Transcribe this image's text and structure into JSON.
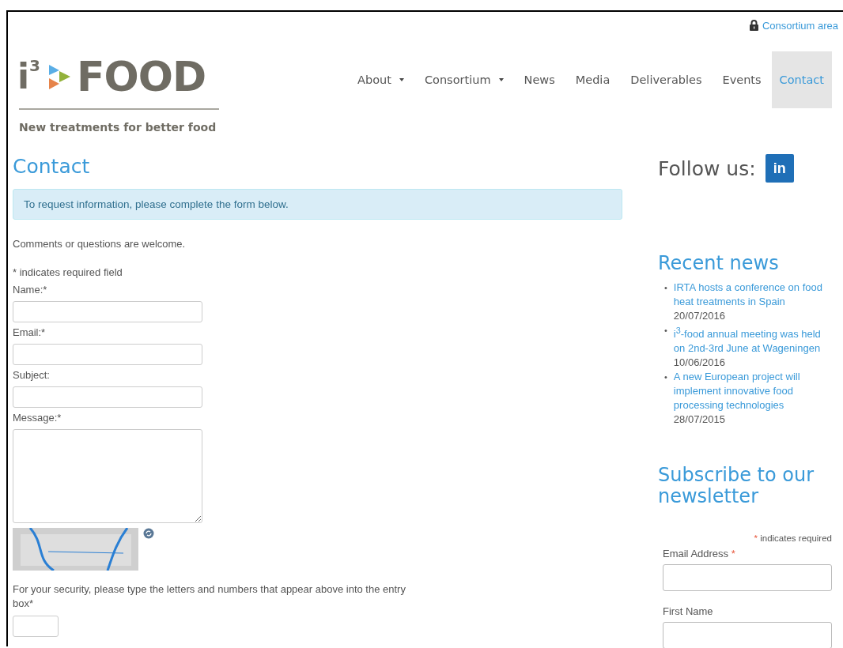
{
  "header": {
    "top_link": "Consortium area",
    "logo": {
      "mark": "i$^{3}$",
      "wordmark": "FOOD",
      "tagline": "New treatments for better food"
    },
    "nav": [
      {
        "label": "About",
        "dropdown": true,
        "selected": false
      },
      {
        "label": "Consortium",
        "dropdown": true,
        "selected": false
      },
      {
        "label": "News",
        "dropdown": false,
        "selected": false
      },
      {
        "label": "Media",
        "dropdown": false,
        "selected": false
      },
      {
        "label": "Deliverables",
        "dropdown": false,
        "selected": false
      },
      {
        "label": "Events",
        "dropdown": false,
        "selected": false
      },
      {
        "label": "Contact",
        "dropdown": false,
        "selected": true
      }
    ]
  },
  "main": {
    "title": "Contact",
    "notice": "To request information, please complete the form below.",
    "intro": "Comments or questions are welcome.",
    "required_note": "* indicates required field",
    "fields": [
      {
        "label": "Name:*",
        "kind": "input"
      },
      {
        "label": "Email:*",
        "kind": "input"
      },
      {
        "label": "Subject:",
        "kind": "input"
      },
      {
        "label": "Message:*",
        "kind": "textarea"
      }
    ],
    "captcha_prompt": "For your security, please type the letters and numbers that appear above into the entry box*"
  },
  "sidebar": {
    "follow_title": "Follow us:",
    "social_label": "in",
    "recent_news": {
      "title": "Recent news",
      "bullet": "•",
      "items": [
        {
          "title": "IRTA hosts a conference on food heat treatments in Spain",
          "date": "20/07/2016"
        },
        {
          "title": "i$^{3}$-food annual meeting was held on 2nd-3rd June at Wageningen",
          "date": "10/06/2016"
        },
        {
          "title": "A new European project will implement innovative food processing technologies",
          "date": "28/07/2015"
        }
      ]
    },
    "newsletter": {
      "title": "Subscribe to our newsletter",
      "required_mark": "*",
      "required_note": "indicates required",
      "fields": [
        {
          "label": "Email Address",
          "mark": "*"
        },
        {
          "label": "First Name"
        }
      ]
    }
  }
}
